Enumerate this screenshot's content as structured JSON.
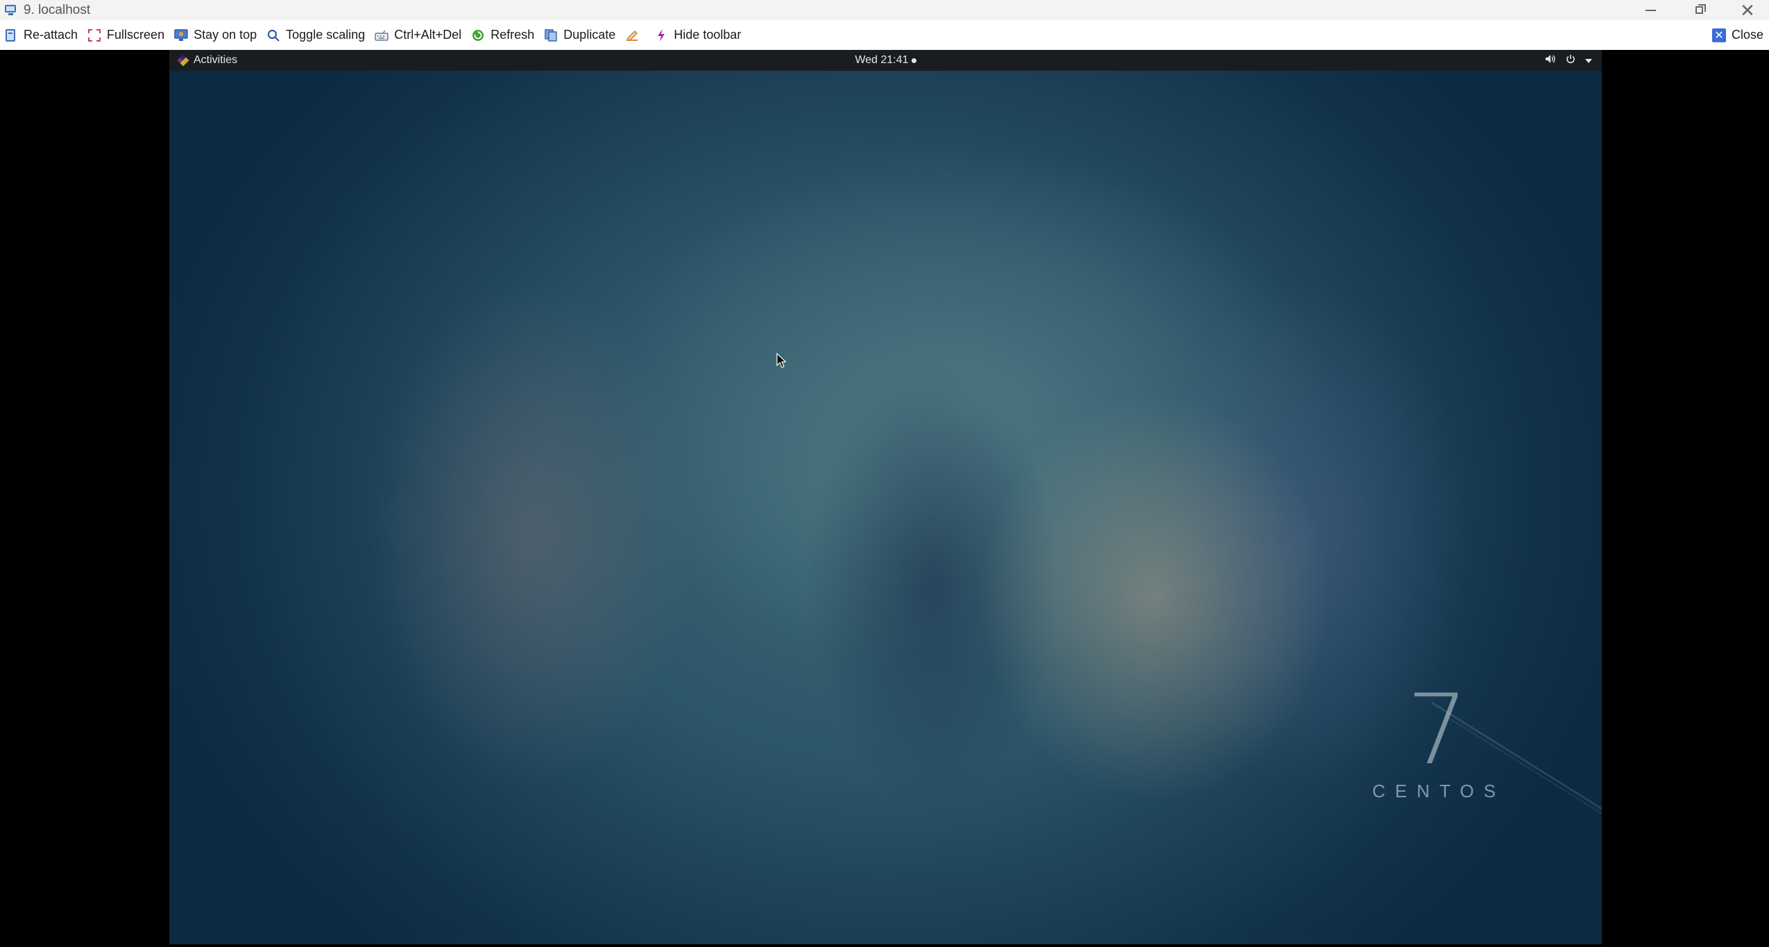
{
  "window": {
    "title": "9. localhost"
  },
  "toolbar": {
    "items": [
      {
        "label": "Re-attach",
        "icon": "reattach-icon"
      },
      {
        "label": "Fullscreen",
        "icon": "fullscreen-icon"
      },
      {
        "label": "Stay on top",
        "icon": "stay-on-top-icon"
      },
      {
        "label": "Toggle scaling",
        "icon": "magnifier-icon"
      },
      {
        "label": "Ctrl+Alt+Del",
        "icon": "keyboard-icon"
      },
      {
        "label": "Refresh",
        "icon": "refresh-icon"
      },
      {
        "label": "Duplicate",
        "icon": "duplicate-icon"
      },
      {
        "label": "",
        "icon": "edit-icon"
      },
      {
        "label": "Hide toolbar",
        "icon": "lightning-icon"
      }
    ],
    "close_label": "Close"
  },
  "remote": {
    "activities_label": "Activities",
    "clock": "Wed 21:41",
    "branding_number": "7",
    "branding_name": "CENTOS"
  },
  "colors": {
    "gnome_bar": "#1a1d20",
    "close_accent": "#3a6dd8"
  }
}
